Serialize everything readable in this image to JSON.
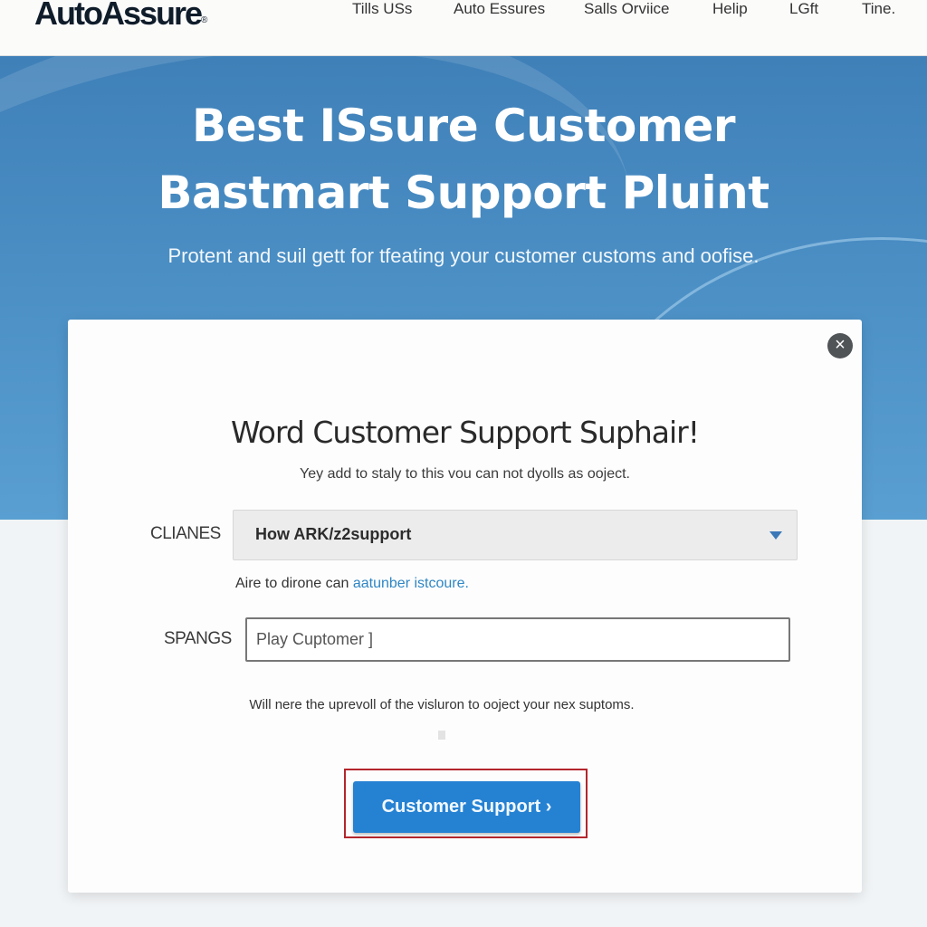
{
  "header": {
    "logo": "AutoAssure",
    "logo_mark": "®",
    "nav": [
      {
        "label": "Tills USs"
      },
      {
        "label": "Auto Essures"
      },
      {
        "label": "Salls Orviice"
      },
      {
        "label": "Helip"
      },
      {
        "label": "LGft"
      },
      {
        "label": "Tine."
      }
    ]
  },
  "hero": {
    "title_line1": "Best ISsure Customer",
    "title_line2": "Bastmart Support Pluint",
    "subtitle": "Protent and suil gett for tfeating your customer customs and oofise."
  },
  "modal": {
    "close_icon": "×",
    "title": "Word Customer Support Suphair!",
    "subtitle": "Yey add to staly to this vou can not dyolls as ooject.",
    "select": {
      "label": "CLIANES",
      "value": "How ARK/z2support"
    },
    "hint": {
      "text": "Aire to dirone can ",
      "link": "aatunber istcoure."
    },
    "input": {
      "label": "SPANGS",
      "value": "Play Cuptomer ]"
    },
    "note": "Will nere the uprevoll of the visluron to ooject your nex suptoms.",
    "button_label": "Customer Support ›"
  },
  "colors": {
    "hero_blue": "#4a8ec4",
    "button_blue": "#2582d3",
    "highlight_red": "#b4262c",
    "link_blue": "#2e86c4"
  }
}
